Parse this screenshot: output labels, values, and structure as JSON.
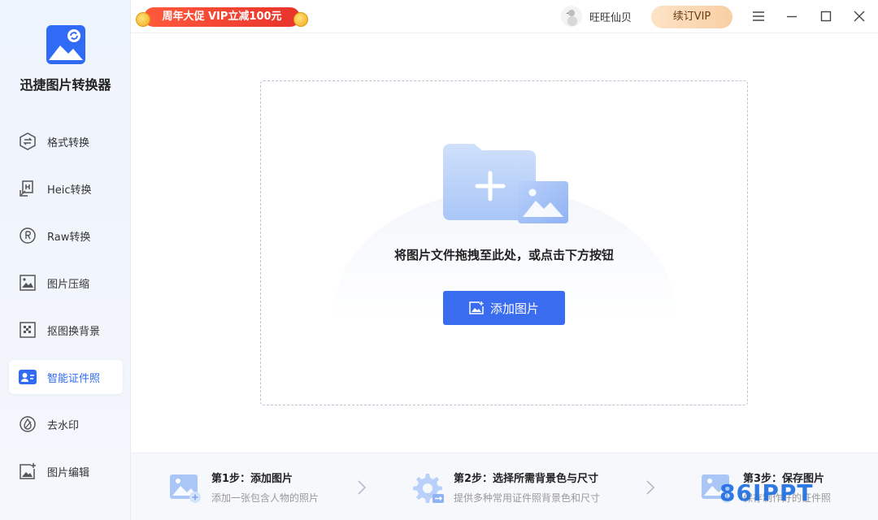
{
  "app": {
    "name": "迅捷图片转换器"
  },
  "promo": {
    "text": "周年大促 VIP立减100元"
  },
  "user": {
    "name": "旺旺仙贝"
  },
  "topbar": {
    "vip_label": "续订VIP"
  },
  "sidebar": {
    "items": [
      {
        "label": "格式转换",
        "icon": "convert-icon",
        "active": false
      },
      {
        "label": "Heic转换",
        "icon": "heic-icon",
        "active": false
      },
      {
        "label": "Raw转换",
        "icon": "raw-icon",
        "active": false
      },
      {
        "label": "图片压缩",
        "icon": "compress-icon",
        "active": false
      },
      {
        "label": "抠图换背景",
        "icon": "cutout-icon",
        "active": false
      },
      {
        "label": "智能证件照",
        "icon": "id-photo-icon",
        "active": true
      },
      {
        "label": "去水印",
        "icon": "watermark-remove-icon",
        "active": false
      },
      {
        "label": "图片编辑",
        "icon": "image-edit-icon",
        "active": false
      }
    ]
  },
  "main": {
    "drop_hint": "将图片文件拖拽至此处，或点击下方按钮",
    "add_button": "添加图片"
  },
  "steps": [
    {
      "title": "第1步：添加图片",
      "desc": "添加一张包含人物的照片"
    },
    {
      "title": "第2步：选择所需背景色与尺寸",
      "desc": "提供多种常用证件照背景色和尺寸"
    },
    {
      "title": "第3步：保存图片",
      "desc": "保存制作好的证件照"
    }
  ],
  "watermark": {
    "text": "86IPPT"
  },
  "colors": {
    "accent": "#3a6cf0",
    "active_text": "#2f6bf5",
    "promo": "#e8332a",
    "vip": "#f8cfa4"
  }
}
